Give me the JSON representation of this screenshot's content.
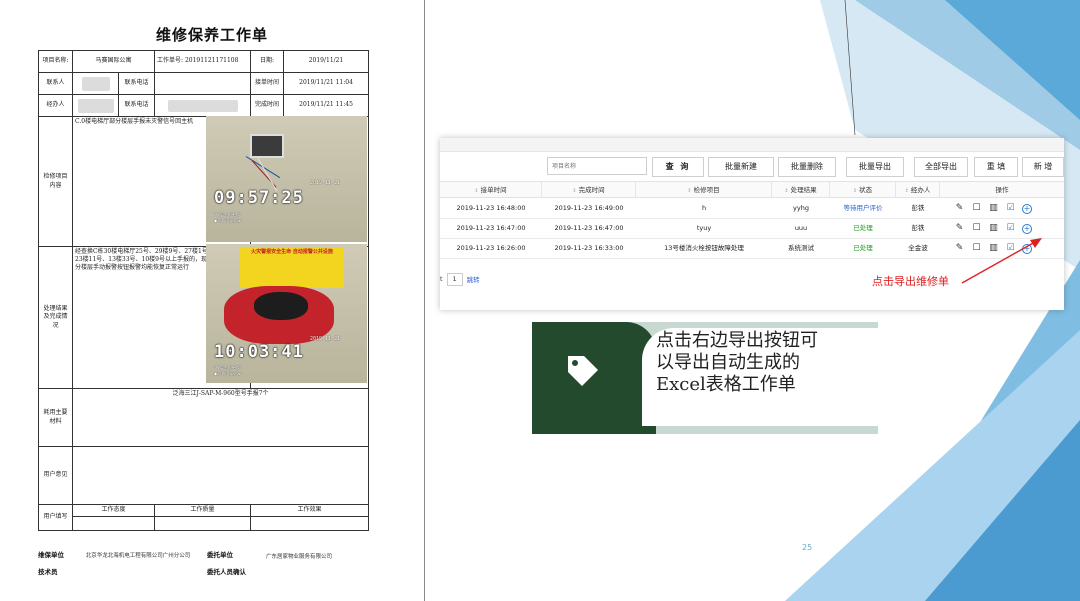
{
  "doc": {
    "title": "维修保养工作单",
    "labels": {
      "project_name": "项目名称:",
      "contact": "联系人",
      "contact_phone": "联系电话",
      "handler": "经办人",
      "handler_phone": "联系电话",
      "work_order_no": "工作单号:",
      "order_no_value": "20191121171108",
      "date": "日期:",
      "date_value": "2019/11/21",
      "receive_time": "接单时间",
      "receive_time_value": "2019/11/21 11:04",
      "complete_time": "完成时间",
      "complete_time_value": "2019/11/21 11:45",
      "repair_content": "检修项目内容",
      "result": "处理结果及完成情况",
      "material": "耗用主要材料",
      "user_opinion": "用户意见",
      "user_eval": "用户填写",
      "work_attitude": "工作态度",
      "work_quality": "工作质量",
      "work_result": "工作效果"
    },
    "project_value": "马赛国际公寓",
    "repair_text": "C.0楼电梯厅部分楼层手报未灭警信号回主机",
    "result_text": "经查换C栋30楼电梯厅25号、29楼9号、27楼1号、26楼65号、23楼11号、13楼33号、10楼9号以上手报的，现C.0栋电梯厅部分楼层手动报警按钮报警均能恢复正常运行",
    "material_text": "泛海三江J-SAP-M-960型号手报7个",
    "photo1": {
      "date": "2019-11-21",
      "time": "09:57:25",
      "caption1": "\"慢层手报更换\"",
      "caption2": "◆马赛国际公寓"
    },
    "photo2": {
      "date": "2019-11-21",
      "time": "10:03:41",
      "caption1": "\"慢层手报更换\"",
      "caption2": "◆马赛国际公寓",
      "sticker": "火灾警报安全生命 自动报警公共设施"
    },
    "footer": {
      "maint_unit_label": "维保单位",
      "maint_unit_value": "北京华龙北海机电工程有限公司广州分公司",
      "client_unit_label": "委托单位",
      "client_unit_value": "广东居家物业服务有限公司",
      "tech_label": "技术员",
      "client_confirm_label": "委托人员确认"
    }
  },
  "toolbar": {
    "search_placeholder": "项目名称",
    "query": "查 询",
    "batch_new": "批量新建",
    "batch_delete": "批量删除",
    "batch_export": "批量导出",
    "export_all": "全部导出",
    "reset": "重 填",
    "add": "新 增"
  },
  "columns": [
    "接单时间",
    "完成时间",
    "检修项目",
    "处理结果",
    "状态",
    "经办人",
    "操作"
  ],
  "rows": [
    {
      "receive": "2019-11-23 16:48:00",
      "complete": "2019-11-23 16:49:00",
      "item": "h",
      "result": "yyhg",
      "status": "等待用户评价",
      "status_color": "blue",
      "handler": "彭铁"
    },
    {
      "receive": "2019-11-23 16:47:00",
      "complete": "2019-11-23 16:47:00",
      "item": "tyuy",
      "result": "uuu",
      "status": "已处理",
      "status_color": "green",
      "handler": "彭铁"
    },
    {
      "receive": "2019-11-23 16:26:00",
      "complete": "2019-11-23 16:33:00",
      "item": "13号楼消火栓按钮故障处理",
      "result": "系统测试",
      "status": "已处理",
      "status_color": "green",
      "handler": "全金波"
    }
  ],
  "pager": {
    "prefix": "t",
    "page": "1",
    "jump": "跳转"
  },
  "annotation": "点击导出维修单",
  "callout": {
    "line1": "点击右边导出按钮可",
    "line2": "以导出自动生成的",
    "line3": "Excel表格工作单"
  },
  "slide_number": "25",
  "colors": {
    "accent_green": "#244a2d",
    "link_blue": "#2a5fd1",
    "ok_green": "#1a9a1a",
    "annotation_red": "#e02020"
  },
  "icons": {
    "edit": "wrench-icon",
    "view": "edit-box-icon",
    "delete": "trash-icon",
    "export": "export-icon",
    "add": "plus-circle-icon",
    "tag": "tag-icon"
  }
}
